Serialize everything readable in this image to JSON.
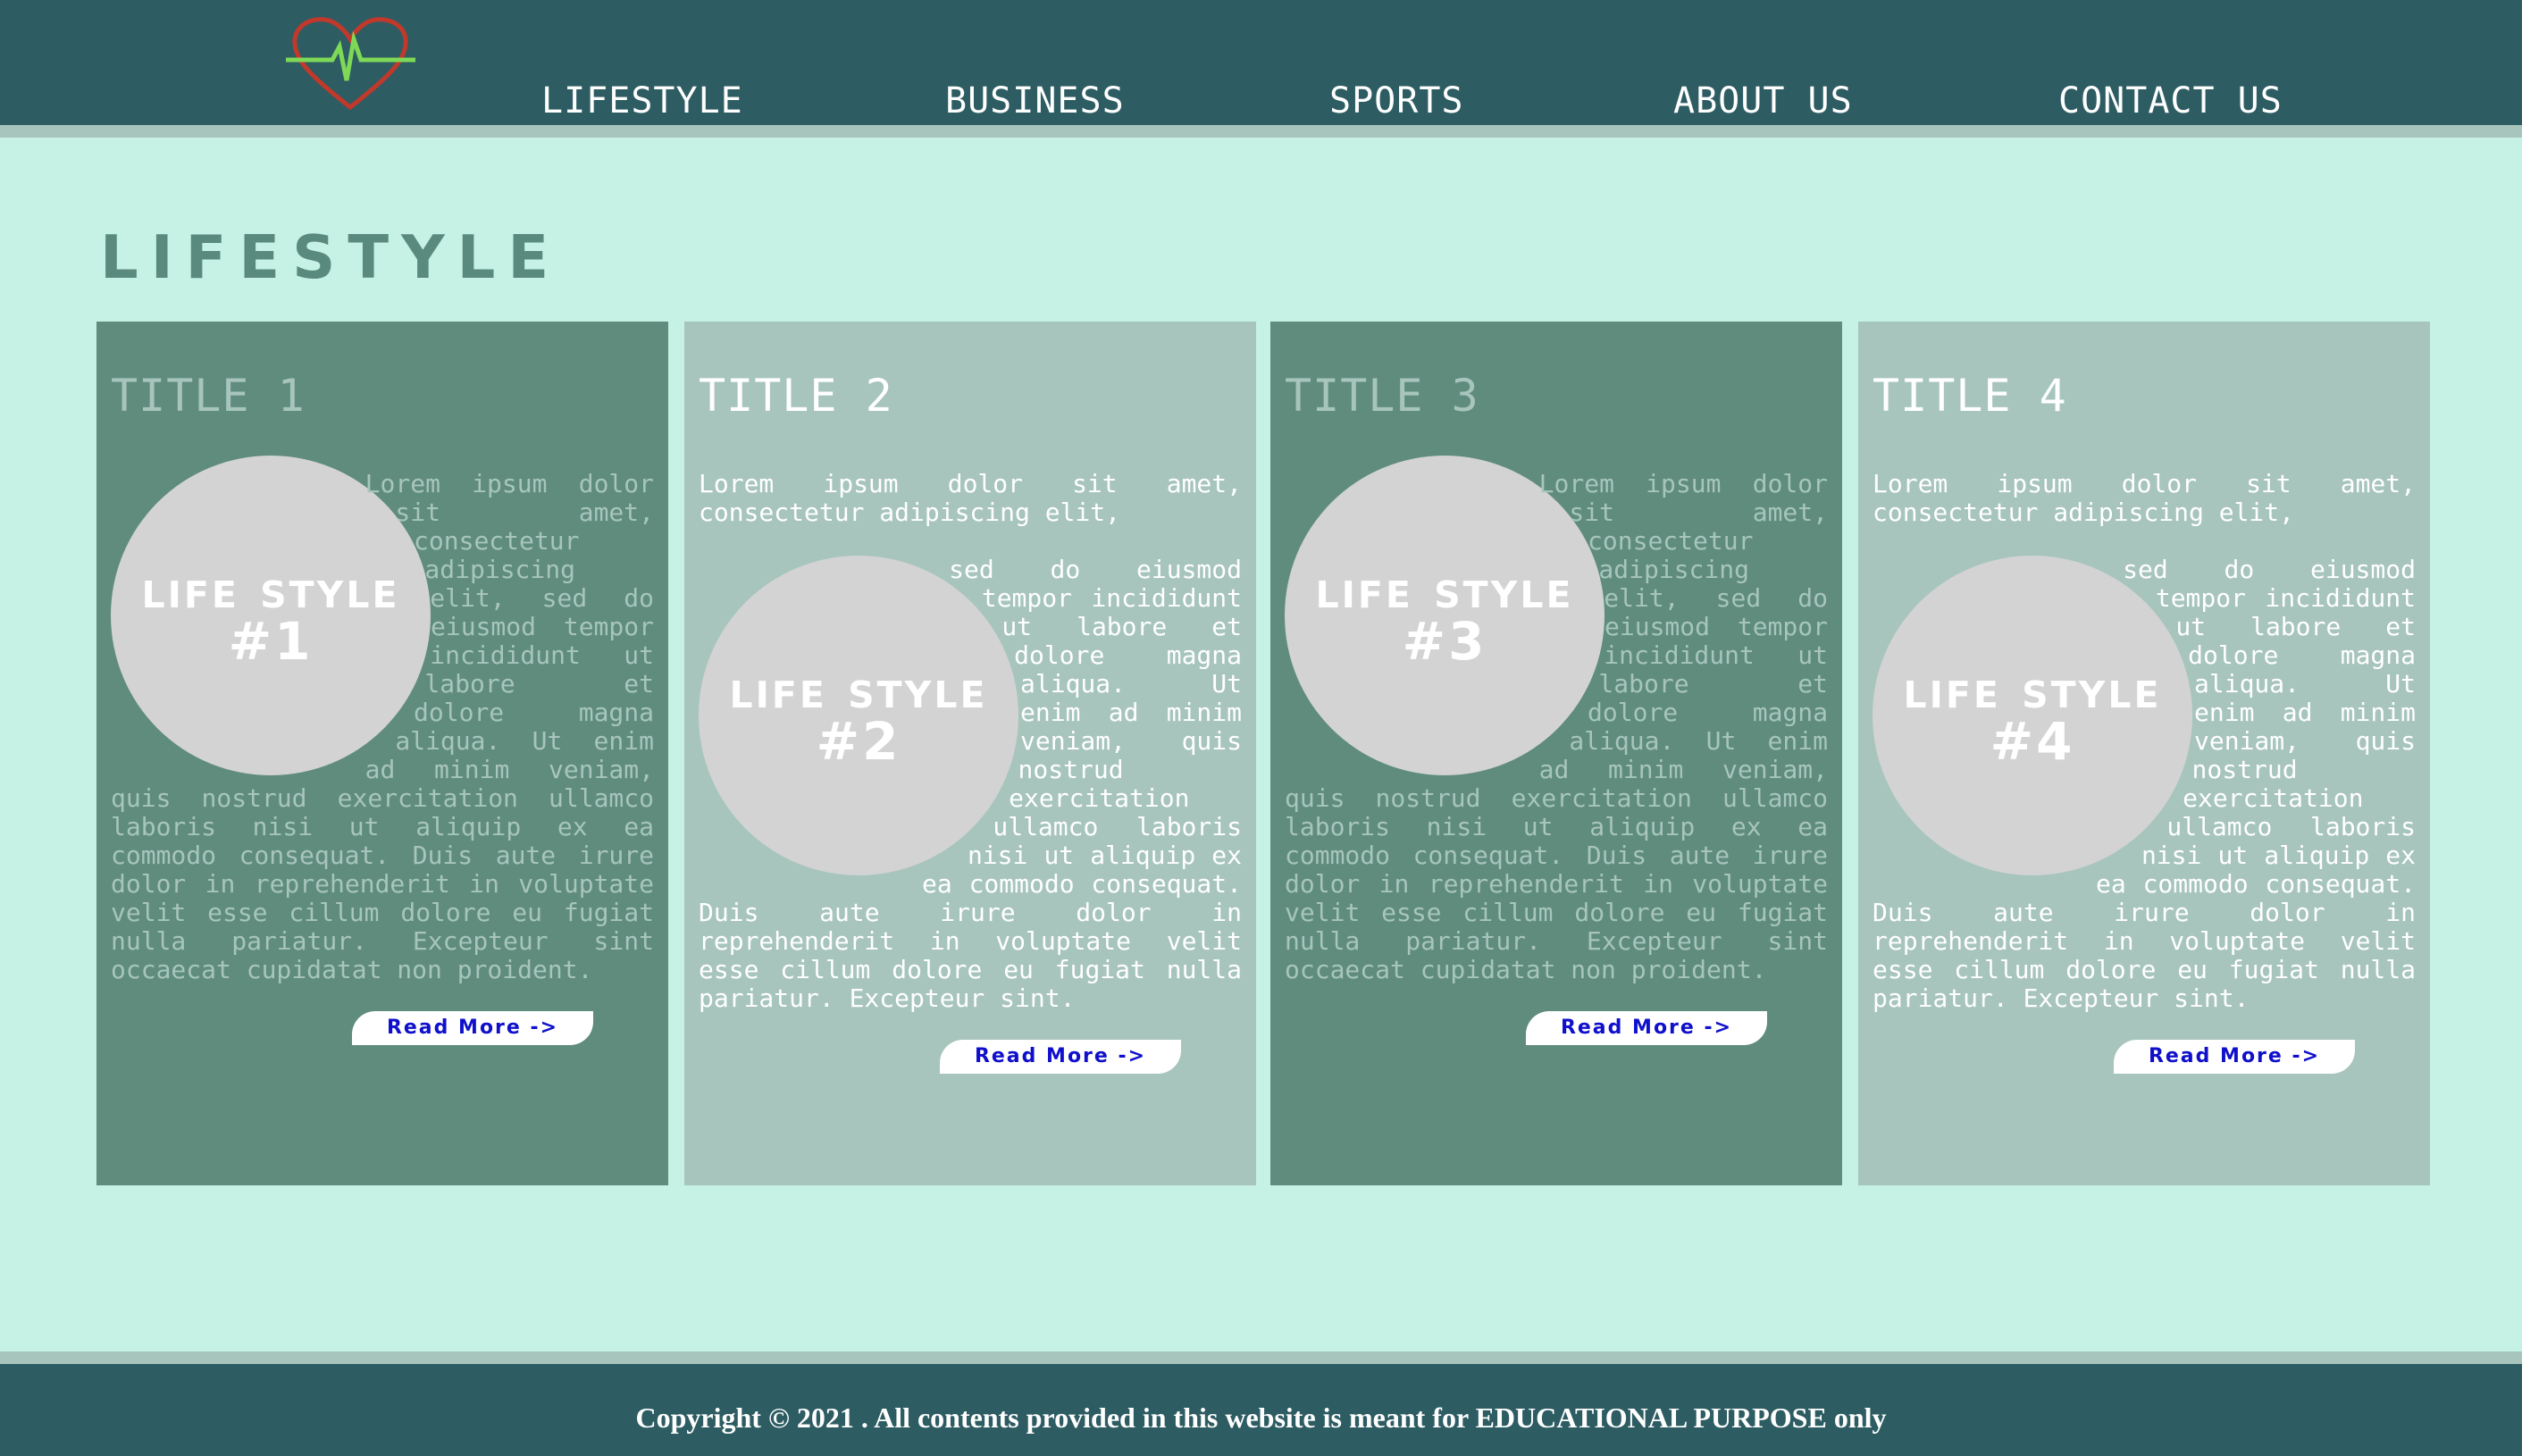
{
  "nav": {
    "items": [
      "LIFESTYLE",
      "BUSINESS",
      "SPORTS",
      "ABOUT US",
      "CONTACT US"
    ]
  },
  "section": {
    "title": "Lifestyle"
  },
  "cards": [
    {
      "title": "TITLE 1",
      "circle_label": "Life style #1",
      "text": "Lorem ipsum dolor sit amet, consectetur adipiscing elit, sed do eiusmod tempor incididunt ut labore et dolore magna aliqua. Ut enim ad minim veniam, quis nostrud exercitation ullamco laboris nisi ut aliquip ex ea commodo consequat. Duis aute irure dolor in reprehenderit in voluptate velit esse cillum dolore eu fugiat nulla pariatur. Excepteur sint occaecat cupidatat non proident.",
      "read_more": "Read More ->"
    },
    {
      "title": "TITLE 2",
      "lead": "Lorem ipsum dolor sit amet, consectetur adipiscing elit,",
      "circle_label": "Life style #2",
      "text": "sed do eiusmod tempor incididunt ut labore et dolore magna aliqua. Ut enim ad minim veniam, quis nostrud exercitation ullamco laboris nisi ut aliquip ex ea commodo consequat. Duis aute irure dolor in reprehenderit in voluptate velit esse cillum dolore eu fugiat nulla pariatur. Excepteur sint.",
      "read_more": "Read More ->"
    },
    {
      "title": "TITLE 3",
      "circle_label": "Life style #3",
      "text": "Lorem ipsum dolor sit amet, consectetur adipiscing elit, sed do eiusmod tempor incididunt ut labore et dolore magna aliqua. Ut enim ad minim veniam, quis nostrud exercitation ullamco laboris nisi ut aliquip ex ea commodo consequat. Duis aute irure dolor in reprehenderit in voluptate velit esse cillum dolore eu fugiat nulla pariatur. Excepteur sint occaecat cupidatat non proident.",
      "read_more": "Read More ->"
    },
    {
      "title": "TITLE 4",
      "lead": "Lorem ipsum dolor sit amet, consectetur adipiscing elit,",
      "circle_label": "Life style #4",
      "text": "sed do eiusmod tempor incididunt ut labore et dolore magna aliqua. Ut enim ad minim veniam, quis nostrud exercitation ullamco laboris nisi ut aliquip ex ea commodo consequat. Duis aute irure dolor in reprehenderit in voluptate velit esse cillum dolore eu fugiat nulla pariatur. Excepteur sint.",
      "read_more": "Read More ->"
    }
  ],
  "footer": {
    "copyright": "Copyright © 2021 . All contents provided in this website is meant for EDUCATIONAL PURPOSE only"
  },
  "colors": {
    "header": "#2d5c63",
    "background": "#c6f1e5",
    "card_dark": "#5f8c7d",
    "card_light": "#a7c5bd",
    "link": "#1010cc",
    "logo_heart": "#c0392b",
    "logo_pulse": "#7ed957"
  },
  "icons": {
    "logo": "heart-pulse-icon"
  }
}
